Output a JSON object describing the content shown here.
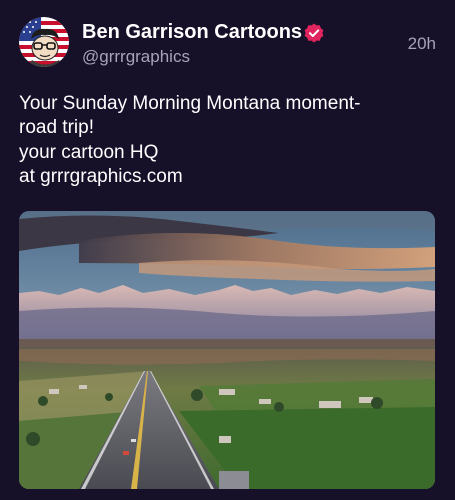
{
  "post": {
    "author_name": "Ben Garrison Cartoons",
    "handle": "@grrrgraphics",
    "timestamp": "20h",
    "text_lines": [
      "Your Sunday Morning Montana moment-",
      "road trip!",
      "your cartoon HQ",
      "at grrrgraphics.com"
    ],
    "avatar_icon": "cartoon-avatar-on-flag",
    "verified_icon": "verified-badge-icon",
    "photo_description_icon": "montana-road-landscape-photo"
  },
  "colors": {
    "background": "#161029",
    "text": "#ffffff",
    "muted_text": "#a7a3b8",
    "verified_badge": "#e0245e"
  }
}
